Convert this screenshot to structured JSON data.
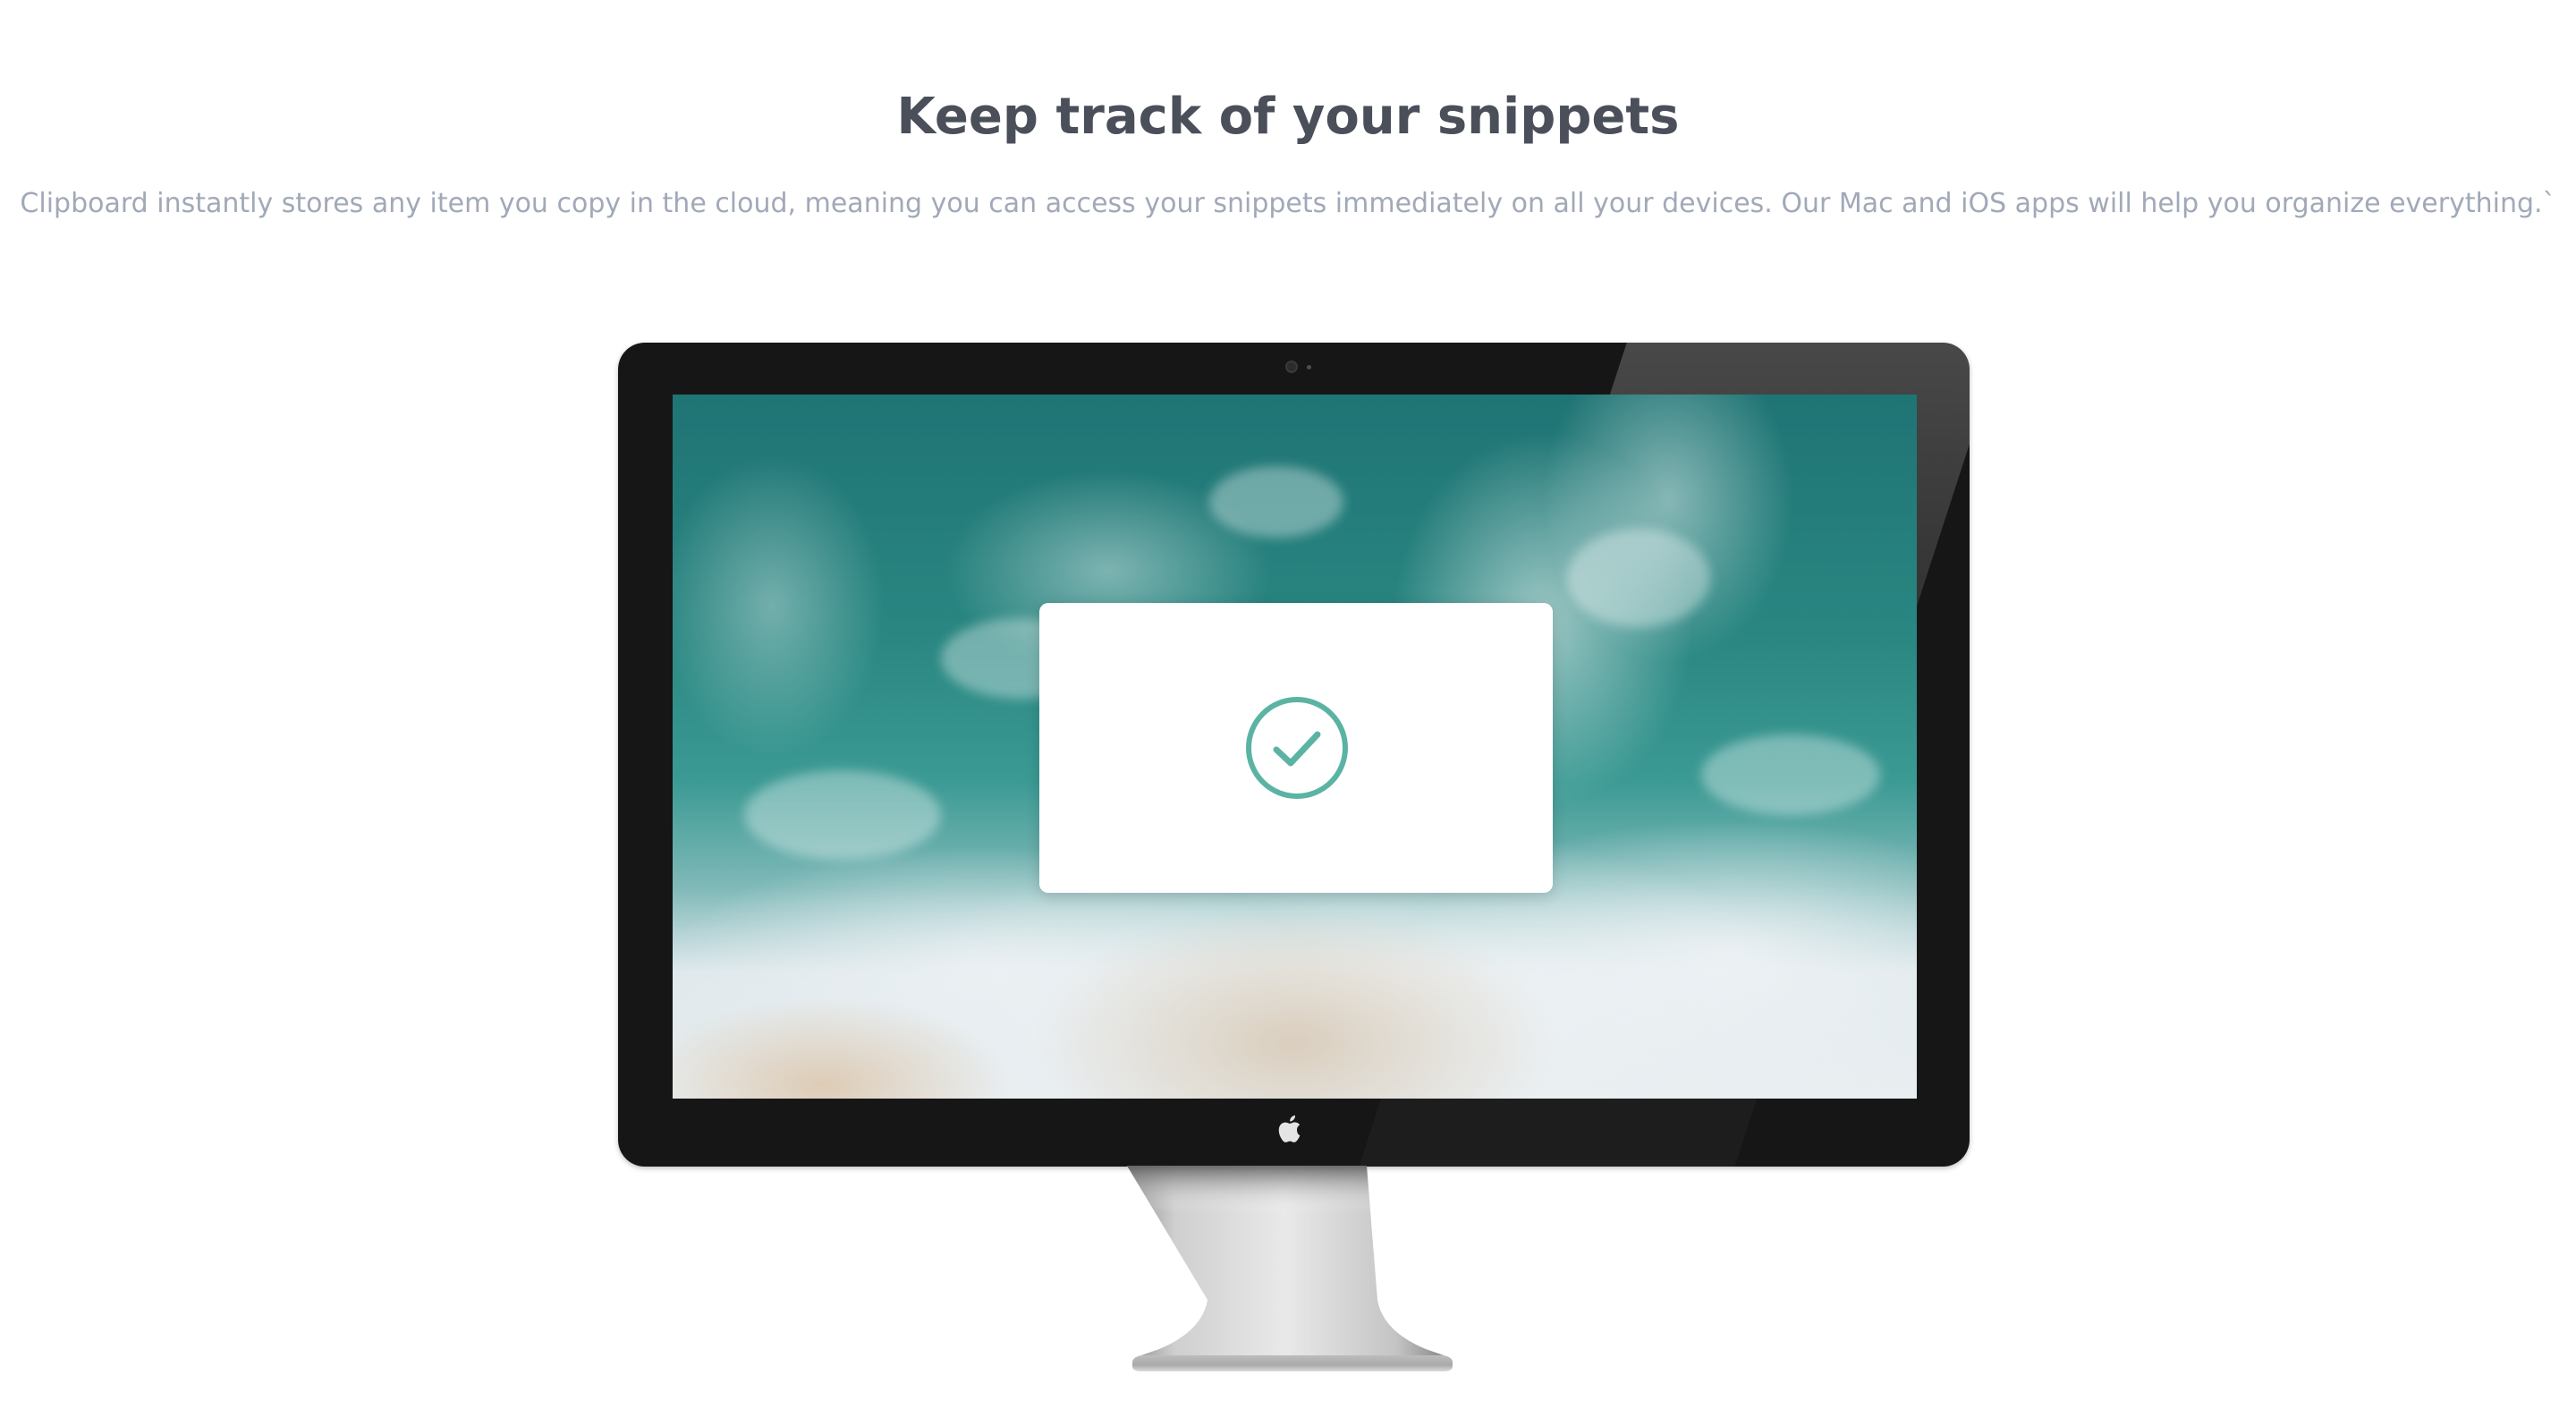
{
  "section": {
    "title": "Keep track of your snippets",
    "description": "Clipboard instantly stores any item you copy in the cloud, meaning you can access your snippets immediately on all your devices. Our Mac and iOS apps will help you organize everything.`"
  },
  "illustration": {
    "device": "imac-monitor",
    "screen_wallpaper": "ocean-waves-aerial",
    "dialog_icon": "check-circle-icon",
    "logo_icon": "apple-logo-icon"
  },
  "colors": {
    "heading": "#4a4f5a",
    "description": "#a1a9b8",
    "check_accent": "#5bb3a4",
    "monitor_bezel": "#161616",
    "background": "#ffffff"
  }
}
